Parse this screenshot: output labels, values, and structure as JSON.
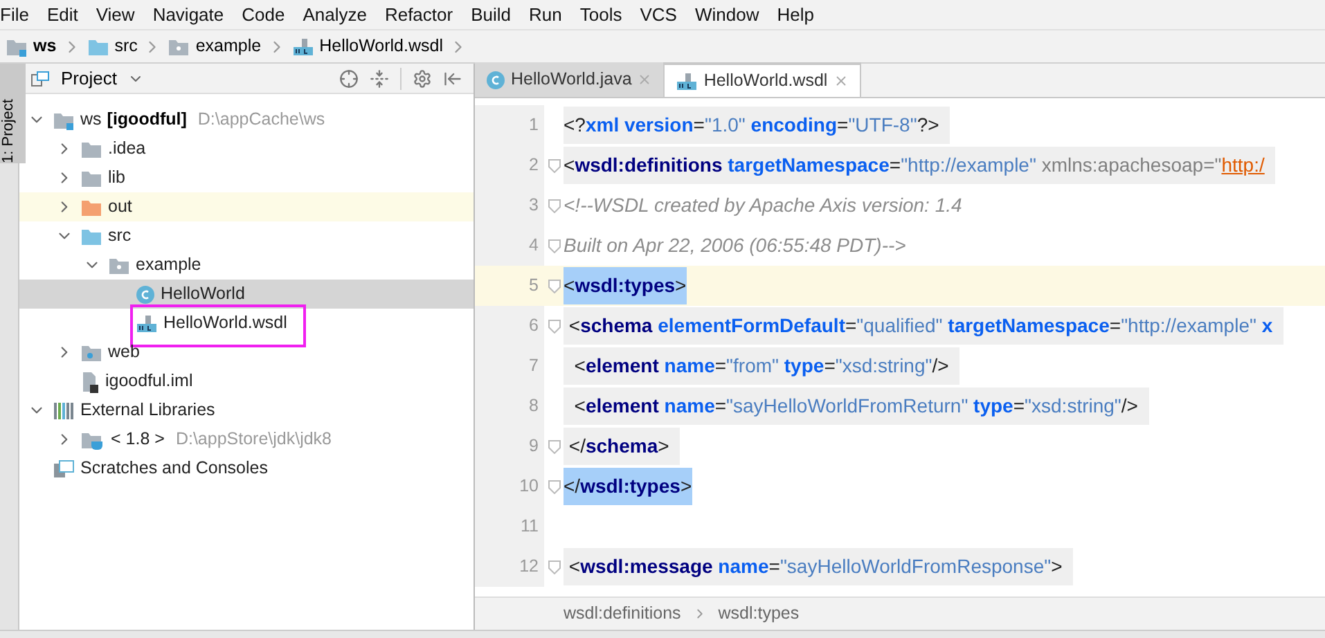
{
  "menu": [
    "File",
    "Edit",
    "View",
    "Navigate",
    "Code",
    "Analyze",
    "Refactor",
    "Build",
    "Run",
    "Tools",
    "VCS",
    "Window",
    "Help"
  ],
  "breadcrumb": [
    {
      "label": "ws",
      "kind": "module"
    },
    {
      "label": "src",
      "kind": "source"
    },
    {
      "label": "example",
      "kind": "package"
    },
    {
      "label": "HelloWorld.wsdl",
      "kind": "wsdl"
    }
  ],
  "side_strip": {
    "label": "1: Project"
  },
  "project_panel": {
    "title": "Project",
    "tree": [
      {
        "label": "ws",
        "module_name": "[igoodful]",
        "path": "D:\\appCache\\ws",
        "kind": "module",
        "expanded": true,
        "selected": false,
        "annotated": false,
        "children": [
          {
            "label": ".idea",
            "kind": "folder",
            "expanded": false,
            "selected": false,
            "annotated": false
          },
          {
            "label": "lib",
            "kind": "folder",
            "expanded": false,
            "selected": false,
            "annotated": false
          },
          {
            "label": "out",
            "kind": "excluded",
            "expanded": false,
            "selected": false,
            "annotated": false
          },
          {
            "label": "src",
            "kind": "source",
            "expanded": true,
            "selected": false,
            "annotated": false,
            "children": [
              {
                "label": "example",
                "kind": "package",
                "expanded": true,
                "selected": false,
                "annotated": false,
                "children": [
                  {
                    "label": "HelloWorld",
                    "kind": "class",
                    "selected": true,
                    "annotated": false
                  },
                  {
                    "label": "HelloWorld.wsdl",
                    "kind": "wsdl",
                    "selected": false,
                    "annotated": true
                  }
                ]
              }
            ]
          },
          {
            "label": "web",
            "kind": "web",
            "expanded": false,
            "selected": false,
            "annotated": false
          },
          {
            "label": "igoodful.iml",
            "kind": "file",
            "selected": false,
            "annotated": false
          }
        ]
      },
      {
        "label": "External Libraries",
        "kind": "libraries",
        "expanded": true,
        "selected": false,
        "annotated": false,
        "children": [
          {
            "label": "< 1.8 >",
            "path": "D:\\appStore\\jdk\\jdk8",
            "kind": "jdk",
            "expanded": false,
            "selected": false,
            "annotated": false
          }
        ]
      },
      {
        "label": "Scratches and Consoles",
        "kind": "scratch",
        "selected": false,
        "annotated": false
      }
    ]
  },
  "editor_tabs": [
    {
      "label": "HelloWorld.java",
      "kind": "class",
      "selected": false
    },
    {
      "label": "HelloWorld.wsdl",
      "kind": "wsdl",
      "selected": true
    }
  ],
  "code_lines": [
    {
      "number": "1",
      "current": false,
      "shaded": true,
      "matched": false,
      "fold": false,
      "tokens": [
        {
          "kind": "punct",
          "text": "<?"
        },
        {
          "kind": "attr",
          "text": "xml version"
        },
        {
          "kind": "punct",
          "text": "="
        },
        {
          "kind": "value",
          "text": "\"1.0\""
        },
        {
          "kind": "attr",
          "text": " encoding"
        },
        {
          "kind": "punct",
          "text": "="
        },
        {
          "kind": "value",
          "text": "\"UTF-8\""
        },
        {
          "kind": "punct",
          "text": "?>"
        }
      ]
    },
    {
      "number": "2",
      "current": false,
      "shaded": true,
      "matched": false,
      "fold": true,
      "tokens": [
        {
          "kind": "punct",
          "text": "<"
        },
        {
          "kind": "tag",
          "text": "wsdl:definitions"
        },
        {
          "kind": "attr",
          "text": " targetNamespace"
        },
        {
          "kind": "punct",
          "text": "="
        },
        {
          "kind": "value",
          "text": "\"http://example\""
        },
        {
          "kind": "plain",
          "text": " xmlns:apachesoap=\""
        },
        {
          "kind": "url",
          "text": "http:/"
        }
      ]
    },
    {
      "number": "3",
      "current": false,
      "shaded": false,
      "matched": false,
      "fold": true,
      "tokens": [
        {
          "kind": "comment",
          "text": "<!--WSDL created by Apache Axis version: 1.4"
        }
      ]
    },
    {
      "number": "4",
      "current": false,
      "shaded": false,
      "matched": false,
      "fold": true,
      "tokens": [
        {
          "kind": "comment",
          "text": "Built on Apr 22, 2006 (06:55:48 PDT)-->"
        }
      ]
    },
    {
      "number": "5",
      "current": true,
      "shaded": false,
      "matched": true,
      "fold": true,
      "tokens": [
        {
          "kind": "punct",
          "text": "<"
        },
        {
          "kind": "tag",
          "text": "wsdl:types"
        },
        {
          "kind": "punct",
          "text": ">"
        }
      ]
    },
    {
      "number": "6",
      "current": false,
      "shaded": true,
      "matched": false,
      "fold": true,
      "tokens": [
        {
          "kind": "punct",
          "text": " <"
        },
        {
          "kind": "tag",
          "text": "schema"
        },
        {
          "kind": "attr",
          "text": " elementFormDefault"
        },
        {
          "kind": "punct",
          "text": "="
        },
        {
          "kind": "value",
          "text": "\"qualified\""
        },
        {
          "kind": "attr",
          "text": " targetNamespace"
        },
        {
          "kind": "punct",
          "text": "="
        },
        {
          "kind": "value",
          "text": "\"http://example\""
        },
        {
          "kind": "attr",
          "text": " x"
        }
      ]
    },
    {
      "number": "7",
      "current": false,
      "shaded": true,
      "matched": false,
      "fold": false,
      "tokens": [
        {
          "kind": "punct",
          "text": "  <"
        },
        {
          "kind": "tag",
          "text": "element"
        },
        {
          "kind": "attr",
          "text": " name"
        },
        {
          "kind": "punct",
          "text": "="
        },
        {
          "kind": "value",
          "text": "\"from\""
        },
        {
          "kind": "attr",
          "text": " type"
        },
        {
          "kind": "punct",
          "text": "="
        },
        {
          "kind": "value",
          "text": "\"xsd:string\""
        },
        {
          "kind": "punct",
          "text": "/>"
        }
      ]
    },
    {
      "number": "8",
      "current": false,
      "shaded": true,
      "matched": false,
      "fold": false,
      "tokens": [
        {
          "kind": "punct",
          "text": "  <"
        },
        {
          "kind": "tag",
          "text": "element"
        },
        {
          "kind": "attr",
          "text": " name"
        },
        {
          "kind": "punct",
          "text": "="
        },
        {
          "kind": "value",
          "text": "\"sayHelloWorldFromReturn\""
        },
        {
          "kind": "attr",
          "text": " type"
        },
        {
          "kind": "punct",
          "text": "="
        },
        {
          "kind": "value",
          "text": "\"xsd:string\""
        },
        {
          "kind": "punct",
          "text": "/>"
        }
      ]
    },
    {
      "number": "9",
      "current": false,
      "shaded": true,
      "matched": false,
      "fold": true,
      "tokens": [
        {
          "kind": "punct",
          "text": " </"
        },
        {
          "kind": "tag",
          "text": "schema"
        },
        {
          "kind": "punct",
          "text": ">"
        }
      ]
    },
    {
      "number": "10",
      "current": false,
      "shaded": false,
      "matched": true,
      "fold": true,
      "tokens": [
        {
          "kind": "punct",
          "text": "</"
        },
        {
          "kind": "tag",
          "text": "wsdl:types"
        },
        {
          "kind": "punct",
          "text": ">"
        }
      ]
    },
    {
      "number": "11",
      "current": false,
      "fold": false
    },
    {
      "number": "12",
      "current": false,
      "shaded": true,
      "matched": false,
      "fold": true,
      "tokens": [
        {
          "kind": "punct",
          "text": " <"
        },
        {
          "kind": "tag",
          "text": "wsdl:message"
        },
        {
          "kind": "attr",
          "text": " name"
        },
        {
          "kind": "punct",
          "text": "="
        },
        {
          "kind": "value",
          "text": "\"sayHelloWorldFromResponse\""
        },
        {
          "kind": "punct",
          "text": ">"
        }
      ]
    }
  ],
  "editor_breadcrumb": [
    "wsdl:definitions",
    "wsdl:types"
  ]
}
